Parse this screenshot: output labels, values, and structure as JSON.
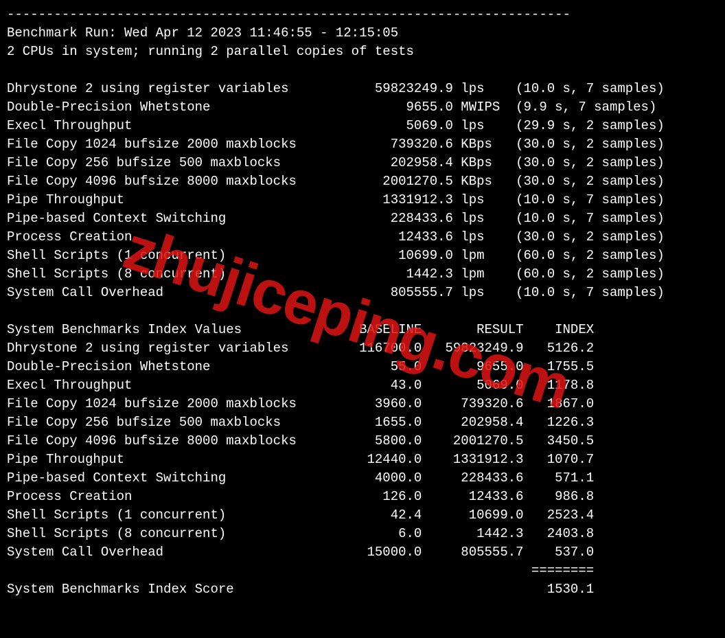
{
  "header_divider": "------------------------------------------------------------------------",
  "run_line": "Benchmark Run: Wed Apr 12 2023 11:46:55 - 12:15:05",
  "cpu_line": "2 CPUs in system; running 2 parallel copies of tests",
  "results": [
    {
      "name": "Dhrystone 2 using register variables",
      "value": "59823249.9",
      "unit": "lps",
      "timing": "(10.0 s, 7 samples)"
    },
    {
      "name": "Double-Precision Whetstone",
      "value": "9655.0",
      "unit": "MWIPS",
      "timing": "(9.9 s, 7 samples)"
    },
    {
      "name": "Execl Throughput",
      "value": "5069.0",
      "unit": "lps",
      "timing": "(29.9 s, 2 samples)"
    },
    {
      "name": "File Copy 1024 bufsize 2000 maxblocks",
      "value": "739320.6",
      "unit": "KBps",
      "timing": "(30.0 s, 2 samples)"
    },
    {
      "name": "File Copy 256 bufsize 500 maxblocks",
      "value": "202958.4",
      "unit": "KBps",
      "timing": "(30.0 s, 2 samples)"
    },
    {
      "name": "File Copy 4096 bufsize 8000 maxblocks",
      "value": "2001270.5",
      "unit": "KBps",
      "timing": "(30.0 s, 2 samples)"
    },
    {
      "name": "Pipe Throughput",
      "value": "1331912.3",
      "unit": "lps",
      "timing": "(10.0 s, 7 samples)"
    },
    {
      "name": "Pipe-based Context Switching",
      "value": "228433.6",
      "unit": "lps",
      "timing": "(10.0 s, 7 samples)"
    },
    {
      "name": "Process Creation",
      "value": "12433.6",
      "unit": "lps",
      "timing": "(30.0 s, 2 samples)"
    },
    {
      "name": "Shell Scripts (1 concurrent)",
      "value": "10699.0",
      "unit": "lpm",
      "timing": "(60.0 s, 2 samples)"
    },
    {
      "name": "Shell Scripts (8 concurrent)",
      "value": "1442.3",
      "unit": "lpm",
      "timing": "(60.0 s, 2 samples)"
    },
    {
      "name": "System Call Overhead",
      "value": "805555.7",
      "unit": "lps",
      "timing": "(10.0 s, 7 samples)"
    }
  ],
  "index_header": {
    "title": "System Benchmarks Index Values",
    "c1": "BASELINE",
    "c2": "RESULT",
    "c3": "INDEX"
  },
  "index_rows": [
    {
      "name": "Dhrystone 2 using register variables",
      "baseline": "116700.0",
      "result": "59823249.9",
      "index": "5126.2"
    },
    {
      "name": "Double-Precision Whetstone",
      "baseline": "55.0",
      "result": "9655.0",
      "index": "1755.5"
    },
    {
      "name": "Execl Throughput",
      "baseline": "43.0",
      "result": "5069.0",
      "index": "1178.8"
    },
    {
      "name": "File Copy 1024 bufsize 2000 maxblocks",
      "baseline": "3960.0",
      "result": "739320.6",
      "index": "1867.0"
    },
    {
      "name": "File Copy 256 bufsize 500 maxblocks",
      "baseline": "1655.0",
      "result": "202958.4",
      "index": "1226.3"
    },
    {
      "name": "File Copy 4096 bufsize 8000 maxblocks",
      "baseline": "5800.0",
      "result": "2001270.5",
      "index": "3450.5"
    },
    {
      "name": "Pipe Throughput",
      "baseline": "12440.0",
      "result": "1331912.3",
      "index": "1070.7"
    },
    {
      "name": "Pipe-based Context Switching",
      "baseline": "4000.0",
      "result": "228433.6",
      "index": "571.1"
    },
    {
      "name": "Process Creation",
      "baseline": "126.0",
      "result": "12433.6",
      "index": "986.8"
    },
    {
      "name": "Shell Scripts (1 concurrent)",
      "baseline": "42.4",
      "result": "10699.0",
      "index": "2523.4"
    },
    {
      "name": "Shell Scripts (8 concurrent)",
      "baseline": "6.0",
      "result": "1442.3",
      "index": "2403.8"
    },
    {
      "name": "System Call Overhead",
      "baseline": "15000.0",
      "result": "805555.7",
      "index": "537.0"
    }
  ],
  "score_divider": "                                                                   ========",
  "score_line_label": "System Benchmarks Index Score",
  "score_line_value": "1530.1",
  "watermark": "zhujiceping.com"
}
